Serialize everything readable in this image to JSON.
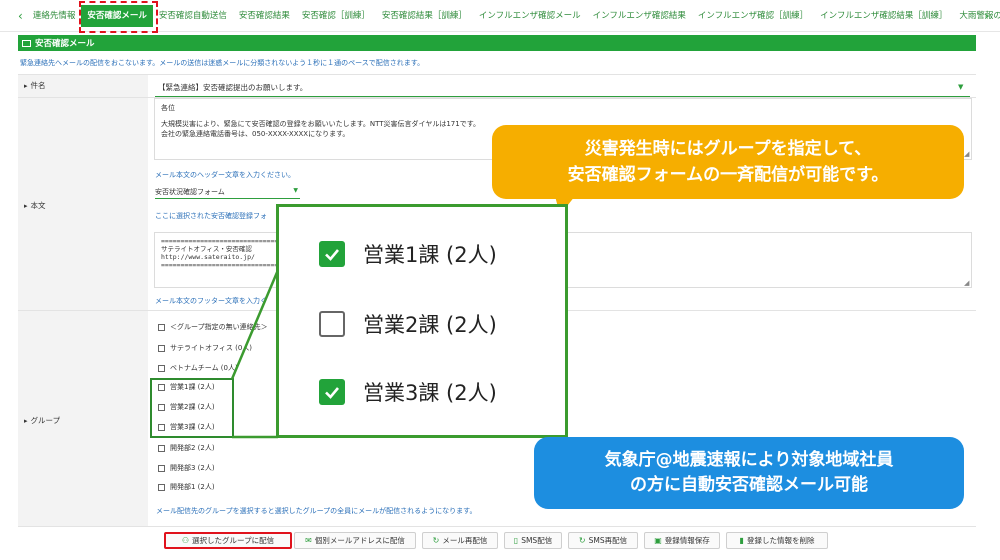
{
  "tabs": [
    {
      "label": "連絡先情報",
      "active": false
    },
    {
      "label": "安否確認メール",
      "active": true
    },
    {
      "label": "安否確認自動送信",
      "active": false
    },
    {
      "label": "安否確認結果",
      "active": false
    },
    {
      "label": "安否確認［訓練］",
      "active": false
    },
    {
      "label": "安否確認結果［訓練］",
      "active": false
    },
    {
      "label": "インフルエンザ確認メール",
      "active": false
    },
    {
      "label": "インフルエンザ確認結果",
      "active": false
    },
    {
      "label": "インフルエンザ確認［訓練］",
      "active": false
    },
    {
      "label": "インフルエンザ確認結果［訓練］",
      "active": false
    },
    {
      "label": "大雨警報の自動送",
      "active": false
    }
  ],
  "section": {
    "title": "安否確認メール",
    "notice": "緊急連絡先へメールの配信をおこないます。メールの送信は迷惑メールに分類されないよう１秒に１通のペースで配信されます。"
  },
  "form": {
    "subject_label": "件名",
    "subject_value": "【緊急連絡】安否確認提出のお願いします。",
    "body_label": "本文",
    "body_lines": [
      "各位",
      "",
      "大規模災害により、緊急にて安否確認の登録をお願いいたします。NTT災害伝言ダイヤルは171です。",
      "会社の緊急連絡電話番号は、050-XXXX-XXXXになります。"
    ],
    "header_hint": "メール本文のヘッダー文章を入力ください。",
    "form_select": "安否状況確認フォーム",
    "form_hint": "ここに選択された安否確認登録フォ",
    "signature_lines": [
      "==============================",
      "サテライトオフィス・安否確認",
      "http://www.sateraito.jp/",
      "=============================="
    ],
    "footer_hint": "メール本文のフッター文章を入力く",
    "group_label": "グループ",
    "groups": [
      "＜グループ指定の無い連絡先＞",
      "サテライトオフィス (0人)",
      "ベトナムチーム (0人)",
      "営業1課 (2人)",
      "営業2課 (2人)",
      "営業3課 (2人)",
      "開発部2 (2人)",
      "開発部3 (2人)",
      "開発部1 (2人)"
    ],
    "group_note": "メール配信先のグループを選択すると選択したグループの全員にメールが配信されるようになります。"
  },
  "buttons": {
    "send_group": "選択したグループに配信",
    "send_individual": "個別メールアドレスに配信",
    "resend_mail": "メール再配信",
    "sms_send": "SMS配信",
    "sms_resend": "SMS再配信",
    "save": "登録情報保存",
    "delete": "登録した情報を削除"
  },
  "zoom": {
    "items": [
      {
        "label": "営業1課 (2人)",
        "checked": true
      },
      {
        "label": "営業2課 (2人)",
        "checked": false
      },
      {
        "label": "営業3課 (2人)",
        "checked": true
      }
    ]
  },
  "callouts": {
    "orange": [
      "災害発生時にはグループを指定して、",
      "安否確認フォームの一斉配信が可能です。"
    ],
    "blue": [
      "気象庁@地震速報により対象地域社員",
      "の方に自動安否確認メール可能"
    ]
  },
  "colors": {
    "brand_green": "#22a33a",
    "highlight_red": "#e0121c",
    "callout_orange": "#f6ae00",
    "callout_blue": "#1d8ee0"
  }
}
